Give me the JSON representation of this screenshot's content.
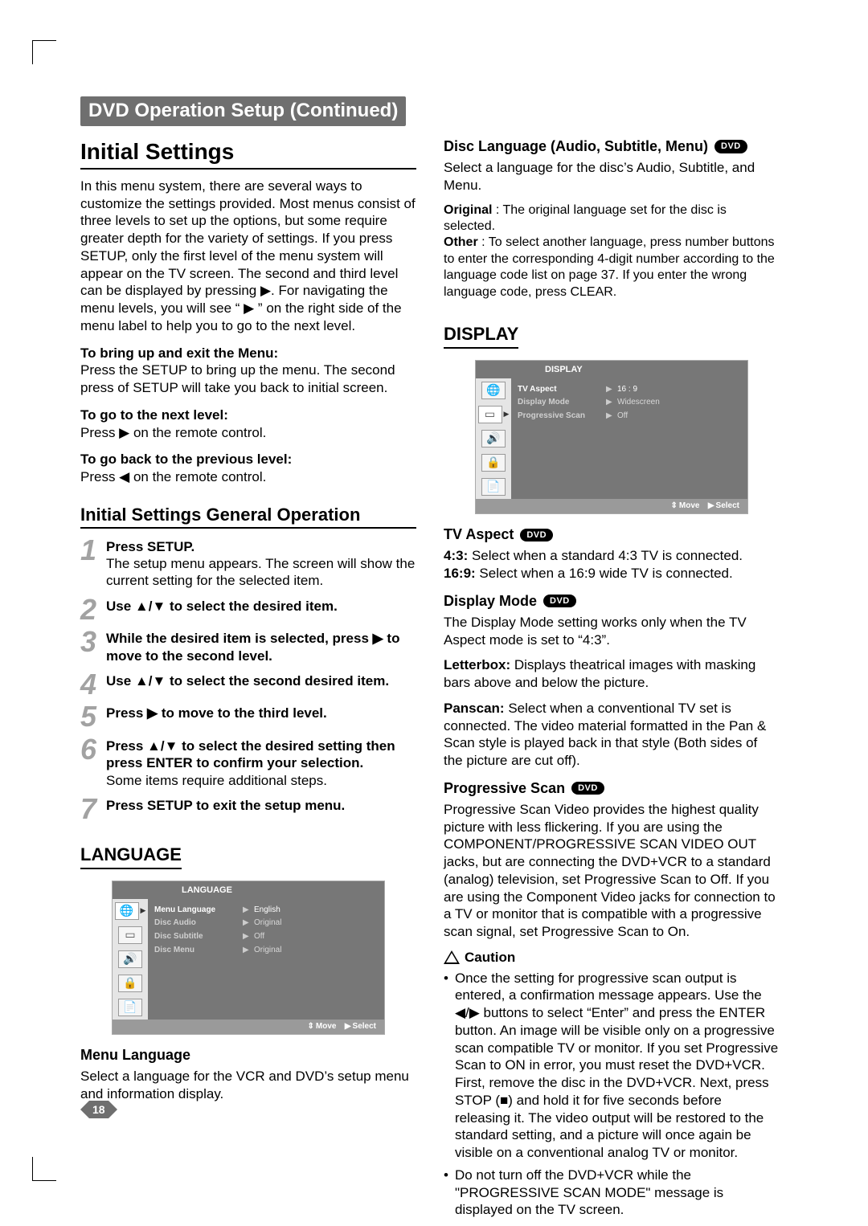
{
  "banner": "DVD Operation Setup (Continued)",
  "page_number": "18",
  "left": {
    "title": "Initial Settings",
    "intro": "In this menu system, there are several ways to customize the settings provided. Most menus consist of three levels to set up the options, but some require greater depth for the variety of settings. If you press SETUP, only the first level of the menu system will appear on the TV screen. The second and third level can be displayed by pressing ▶. For navigating the menu levels, you will see “ ▶ ” on the right side of the menu label to help you to go to the next level.",
    "bring_up_h": "To bring up and exit the Menu:",
    "bring_up_p": "Press the SETUP to bring up the menu. The second press of SETUP will take you back to initial screen.",
    "next_h": "To go to the next level:",
    "next_p": "Press ▶ on the remote control.",
    "prev_h": "To go back to the previous level:",
    "prev_p": "Press ◀ on the remote control.",
    "genop_title": "Initial Settings General Operation",
    "steps": [
      {
        "n": "1",
        "t": "Press SETUP.",
        "b": "The setup menu appears. The screen will show the current setting for the selected item."
      },
      {
        "n": "2",
        "t": "Use ▲/▼ to select the desired item.",
        "b": ""
      },
      {
        "n": "3",
        "t": "While the desired item is selected, press ▶ to move to the second level.",
        "b": ""
      },
      {
        "n": "4",
        "t": "Use ▲/▼ to select the second desired item.",
        "b": ""
      },
      {
        "n": "5",
        "t": "Press ▶ to move to the third level.",
        "b": ""
      },
      {
        "n": "6",
        "t": "Press ▲/▼ to select the desired setting then press ENTER to confirm your selection.",
        "b": "Some items require additional steps."
      },
      {
        "n": "7",
        "t": "Press SETUP to exit the setup menu.",
        "b": ""
      }
    ],
    "language_title": "LANGUAGE",
    "osd_lang": {
      "header": "LANGUAGE",
      "rows": [
        {
          "lbl": "Menu Language",
          "val": "English",
          "hl": true
        },
        {
          "lbl": "Disc Audio",
          "val": "Original"
        },
        {
          "lbl": "Disc Subtitle",
          "val": "Off"
        },
        {
          "lbl": "Disc Menu",
          "val": "Original"
        }
      ],
      "foot_move": "Move",
      "foot_select": "Select"
    },
    "menu_lang_h": "Menu Language",
    "menu_lang_p": "Select a language for the VCR and DVD’s setup menu and information display."
  },
  "right": {
    "disc_lang_h": "Disc Language (Audio, Subtitle, Menu)",
    "dvd_badge": "DVD",
    "disc_lang_p1": "Select a language for the disc’s Audio, Subtitle, and Menu.",
    "disc_lang_p2a": "Original",
    "disc_lang_p2b": " : The original language set for the disc is selected.",
    "disc_lang_p3a": "Other",
    "disc_lang_p3b": " : To select another language, press number buttons to enter the corresponding 4-digit number according to the language code list on page 37. If you enter the wrong language code, press CLEAR.",
    "display_title": "DISPLAY",
    "osd_disp": {
      "header": "DISPLAY",
      "rows": [
        {
          "lbl": "TV Aspect",
          "val": "16  :  9",
          "hl": true
        },
        {
          "lbl": "Display Mode",
          "val": "Widescreen"
        },
        {
          "lbl": "Progressive Scan",
          "val": "Off"
        }
      ],
      "foot_move": "Move",
      "foot_select": "Select"
    },
    "tv_aspect_h": "TV Aspect",
    "tv_aspect_43a": "4:3:",
    "tv_aspect_43b": " Select when a standard 4:3 TV is connected.",
    "tv_aspect_169a": "16:9:",
    "tv_aspect_169b": " Select when a 16:9 wide TV is connected.",
    "disp_mode_h": "Display Mode",
    "disp_mode_p1": "The Display Mode setting works only when the TV Aspect mode is set to “4:3”.",
    "disp_mode_lb_a": "Letterbox:",
    "disp_mode_lb_b": " Displays theatrical images with masking bars above and below the picture.",
    "disp_mode_ps_a": "Panscan:",
    "disp_mode_ps_b": " Select when a conventional TV set is connected. The video material formatted in the Pan & Scan style is played back in that style (Both sides of the picture are cut off).",
    "prog_h": "Progressive Scan",
    "prog_p": "Progressive Scan Video provides the highest quality picture with less flickering. If you are using the COMPONENT/PROGRESSIVE SCAN VIDEO OUT jacks, but are connecting the DVD+VCR to a standard (analog) television, set Progressive Scan to Off. If you are using the Component Video jacks for connection to a TV or monitor that is compatible with a progressive scan signal, set Progressive Scan to On.",
    "caution_h": "Caution",
    "caution_1": "Once the setting for progressive scan output is entered, a confirmation message appears. Use the ◀/▶ buttons to select “Enter” and press the ENTER button. An image will be visible only on a progressive scan compatible TV or monitor. If you set Progressive Scan to ON in error, you must reset the DVD+VCR. First, remove the disc in the DVD+VCR. Next, press STOP (■) and hold it for five seconds before releasing it. The video output will be restored to the standard setting, and a picture will once again be visible on a conventional analog TV or monitor.",
    "caution_2": "Do not turn off the DVD+VCR while the \"PROGRESSIVE SCAN MODE\" message is displayed on the TV screen."
  }
}
